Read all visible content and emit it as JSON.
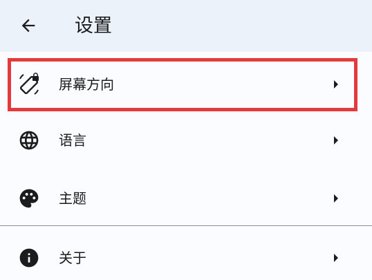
{
  "header": {
    "title": "设置",
    "back_icon": "arrow-back-icon"
  },
  "settings": {
    "items": [
      {
        "label": "屏幕方向",
        "icon": "screen-rotation-lock-icon"
      },
      {
        "label": "语言",
        "icon": "globe-icon"
      },
      {
        "label": "主题",
        "icon": "palette-icon"
      },
      {
        "label": "关于",
        "icon": "info-icon"
      }
    ]
  },
  "colors": {
    "header_bg": "#ecf2fa",
    "page_bg": "#fbfcff",
    "highlight": "#e53a3d",
    "text": "#1a1c1e"
  }
}
